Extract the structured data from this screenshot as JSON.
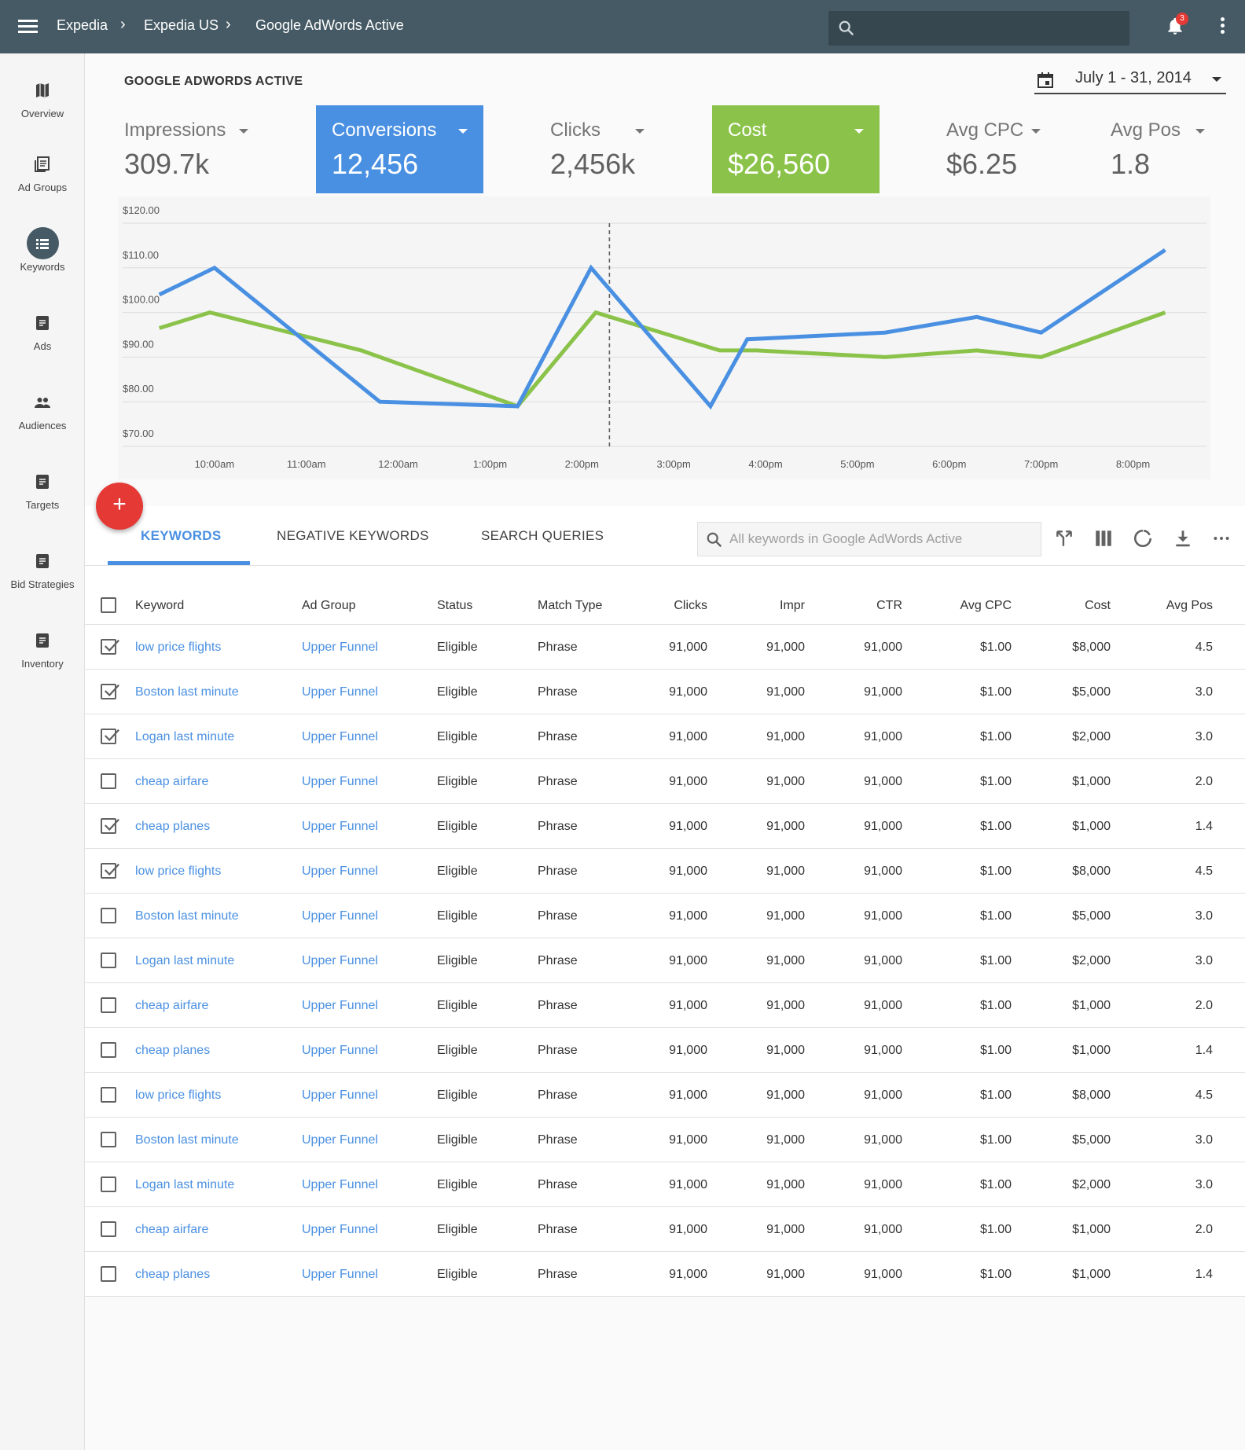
{
  "breadcrumb": {
    "items": [
      "Expedia",
      "Expedia US",
      "Google AdWords Active"
    ],
    "separator": "›"
  },
  "notifications": {
    "count": "3"
  },
  "sidebar": {
    "items": [
      {
        "label": "Overview",
        "icon": "map-icon",
        "active": false
      },
      {
        "label": "Ad Groups",
        "icon": "ad-groups-icon",
        "active": false
      },
      {
        "label": "Keywords",
        "icon": "keywords-icon",
        "active": true
      },
      {
        "label": "Ads",
        "icon": "document-icon",
        "active": false
      },
      {
        "label": "Audiences",
        "icon": "people-icon",
        "active": false
      },
      {
        "label": "Targets",
        "icon": "document-icon",
        "active": false
      },
      {
        "label": "Bid Strategies",
        "icon": "document-icon",
        "active": false
      },
      {
        "label": "Inventory",
        "icon": "document-icon",
        "active": false
      }
    ]
  },
  "page": {
    "title": "GOOGLE ADWORDS ACTIVE",
    "date_range": "July 1 - 31, 2014"
  },
  "metrics": [
    {
      "label": "Impressions",
      "value": "309.7k",
      "style": "plain"
    },
    {
      "label": "Conversions",
      "value": "12,456",
      "style": "blue"
    },
    {
      "label": "Clicks",
      "value": "2,456k",
      "style": "plain"
    },
    {
      "label": "Cost",
      "value": "$26,560",
      "style": "green"
    },
    {
      "label": "Avg CPC",
      "value": "$6.25",
      "style": "plain"
    },
    {
      "label": "Avg Pos",
      "value": "1.8",
      "style": "plain"
    }
  ],
  "colors": {
    "topbar": "#455a64",
    "blue": "#4a90e2",
    "green": "#8bc34a",
    "fab": "#e53935"
  },
  "chart_data": {
    "type": "line",
    "x": [
      "10:00am",
      "11:00am",
      "12:00am",
      "1:00pm",
      "2:00pm",
      "3:00pm",
      "4:00pm",
      "5:00pm",
      "6:00pm",
      "7:00pm",
      "8:00pm"
    ],
    "y_ticks": [
      "$70.00",
      "$80.00",
      "$90.00",
      "$100.00",
      "$110.00",
      "$120.00"
    ],
    "ylim": [
      70,
      120
    ],
    "grid": true,
    "series": [
      {
        "color": "#4a90e2",
        "points": [
          [
            9.4,
            104
          ],
          [
            10.0,
            110
          ],
          [
            11.8,
            80
          ],
          [
            13.3,
            79
          ],
          [
            14.1,
            110
          ],
          [
            15.4,
            79
          ],
          [
            15.8,
            94
          ],
          [
            17.3,
            95.5
          ],
          [
            18.3,
            99
          ],
          [
            19.0,
            95.5
          ],
          [
            20.35,
            114
          ]
        ]
      },
      {
        "color": "#8bc34a",
        "points": [
          [
            9.4,
            96.5
          ],
          [
            9.95,
            100
          ],
          [
            11.6,
            91.5
          ],
          [
            13.3,
            79
          ],
          [
            14.15,
            100
          ],
          [
            15.5,
            91.5
          ],
          [
            15.9,
            91.5
          ],
          [
            17.3,
            90
          ],
          [
            18.3,
            91.5
          ],
          [
            19.0,
            90
          ],
          [
            20.35,
            100
          ]
        ]
      }
    ],
    "marker_x": 14.3
  },
  "fab": {
    "label": "+"
  },
  "tabs": [
    {
      "label": "KEYWORDS",
      "active": true
    },
    {
      "label": "NEGATIVE KEYWORDS",
      "active": false
    },
    {
      "label": "SEARCH QUERIES",
      "active": false
    }
  ],
  "toolbar": {
    "search_placeholder": "All keywords in Google AdWords Active",
    "icons": [
      "filter-icon",
      "columns-icon",
      "refresh-icon",
      "download-icon",
      "more-horizontal-icon"
    ]
  },
  "table": {
    "columns": [
      "Keyword",
      "Ad Group",
      "Status",
      "Match Type",
      "Clicks",
      "Impr",
      "CTR",
      "Avg CPC",
      "Cost",
      "Avg Pos"
    ],
    "rows": [
      {
        "checked": true,
        "cells": [
          "low price flights",
          "Upper Funnel",
          "Eligible",
          "Phrase",
          "91,000",
          "91,000",
          "91,000",
          "$1.00",
          "$8,000",
          "4.5"
        ]
      },
      {
        "checked": true,
        "cells": [
          "Boston last minute",
          "Upper Funnel",
          "Eligible",
          "Phrase",
          "91,000",
          "91,000",
          "91,000",
          "$1.00",
          "$5,000",
          "3.0"
        ]
      },
      {
        "checked": true,
        "cells": [
          "Logan last minute",
          "Upper Funnel",
          "Eligible",
          "Phrase",
          "91,000",
          "91,000",
          "91,000",
          "$1.00",
          "$2,000",
          "3.0"
        ]
      },
      {
        "checked": false,
        "cells": [
          "cheap airfare",
          "Upper Funnel",
          "Eligible",
          "Phrase",
          "91,000",
          "91,000",
          "91,000",
          "$1.00",
          "$1,000",
          "2.0"
        ]
      },
      {
        "checked": true,
        "cells": [
          "cheap planes",
          "Upper Funnel",
          "Eligible",
          "Phrase",
          "91,000",
          "91,000",
          "91,000",
          "$1.00",
          "$1,000",
          "1.4"
        ]
      },
      {
        "checked": true,
        "cells": [
          "low price flights",
          "Upper Funnel",
          "Eligible",
          "Phrase",
          "91,000",
          "91,000",
          "91,000",
          "$1.00",
          "$8,000",
          "4.5"
        ]
      },
      {
        "checked": false,
        "cells": [
          "Boston last minute",
          "Upper Funnel",
          "Eligible",
          "Phrase",
          "91,000",
          "91,000",
          "91,000",
          "$1.00",
          "$5,000",
          "3.0"
        ]
      },
      {
        "checked": false,
        "cells": [
          "Logan last minute",
          "Upper Funnel",
          "Eligible",
          "Phrase",
          "91,000",
          "91,000",
          "91,000",
          "$1.00",
          "$2,000",
          "3.0"
        ]
      },
      {
        "checked": false,
        "cells": [
          "cheap airfare",
          "Upper Funnel",
          "Eligible",
          "Phrase",
          "91,000",
          "91,000",
          "91,000",
          "$1.00",
          "$1,000",
          "2.0"
        ]
      },
      {
        "checked": false,
        "cells": [
          "cheap planes",
          "Upper Funnel",
          "Eligible",
          "Phrase",
          "91,000",
          "91,000",
          "91,000",
          "$1.00",
          "$1,000",
          "1.4"
        ]
      },
      {
        "checked": false,
        "cells": [
          "low price flights",
          "Upper Funnel",
          "Eligible",
          "Phrase",
          "91,000",
          "91,000",
          "91,000",
          "$1.00",
          "$8,000",
          "4.5"
        ]
      },
      {
        "checked": false,
        "cells": [
          "Boston last minute",
          "Upper Funnel",
          "Eligible",
          "Phrase",
          "91,000",
          "91,000",
          "91,000",
          "$1.00",
          "$5,000",
          "3.0"
        ]
      },
      {
        "checked": false,
        "cells": [
          "Logan last minute",
          "Upper Funnel",
          "Eligible",
          "Phrase",
          "91,000",
          "91,000",
          "91,000",
          "$1.00",
          "$2,000",
          "3.0"
        ]
      },
      {
        "checked": false,
        "cells": [
          "cheap airfare",
          "Upper Funnel",
          "Eligible",
          "Phrase",
          "91,000",
          "91,000",
          "91,000",
          "$1.00",
          "$1,000",
          "2.0"
        ]
      },
      {
        "checked": false,
        "cells": [
          "cheap planes",
          "Upper Funnel",
          "Eligible",
          "Phrase",
          "91,000",
          "91,000",
          "91,000",
          "$1.00",
          "$1,000",
          "1.4"
        ]
      }
    ]
  }
}
